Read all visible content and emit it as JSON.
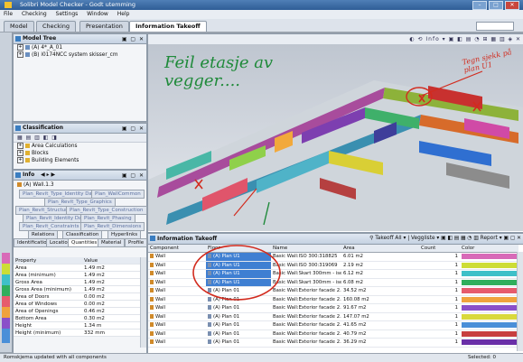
{
  "window": {
    "title": "Solibri Model Checker - Godt utemming"
  },
  "menu": [
    "File",
    "Checking",
    "Settings",
    "Window",
    "Help"
  ],
  "tabs": [
    {
      "label": "Model",
      "active": false
    },
    {
      "label": "Checking",
      "active": false
    },
    {
      "label": "Presentation",
      "active": false
    },
    {
      "label": "Information Takeoff",
      "active": true
    }
  ],
  "model_tree": {
    "title": "Model Tree",
    "items": [
      {
        "label": "(A) 4*_A_01"
      },
      {
        "label": "(B) i0174NCC system skisser_cm"
      }
    ]
  },
  "classification": {
    "title": "Classification",
    "items": [
      "Area Calculations",
      "Blocks",
      "Building Elements"
    ]
  },
  "info": {
    "title": "Info",
    "selection": "(A) Wall.1.3",
    "prop_tabs_row1": [
      "Plan_Revit_Type_Identity Data",
      "Plan_WallCommon"
    ],
    "prop_tabs_row2": [
      "Plan_Revit_Type_Graphics"
    ],
    "prop_tabs_row3": [
      "Plan_Revit_Structural",
      "Plan_Revit_Type_Construction"
    ],
    "prop_tabs_row4": [
      "Plan_Revit_Identity Data",
      "Plan_Revit_Phasing"
    ],
    "prop_tabs_row5": [
      "Plan_Revit_Constraints",
      "Plan_Revit_Dimensions"
    ],
    "prop_tabs_row6": [
      "Relations",
      "Classification",
      "Hyperlinks"
    ],
    "prop_tabs_row7": [
      "Identification",
      "Location",
      "Quantities",
      "Material",
      "Profile"
    ],
    "columns": [
      "Property",
      "Value"
    ],
    "rows": [
      [
        "Area",
        "1.49 m2"
      ],
      [
        "Area (minimum)",
        "1.49 m2"
      ],
      [
        "Gross Area",
        "1.49 m2"
      ],
      [
        "Gross Area (minimum)",
        "1.49 m2"
      ],
      [
        "Area of Doors",
        "0.00 m2"
      ],
      [
        "Area of Windows",
        "0.00 m2"
      ],
      [
        "Area of Openings",
        "0.46 m2"
      ],
      [
        "Bottom Area",
        "0.30 m2"
      ],
      [
        "Height",
        "1.34 m"
      ],
      [
        "Height (minimum)",
        "332 mm"
      ]
    ]
  },
  "takeoff": {
    "title": "Information Takeoff",
    "toolbar_takeoff": "Takeoff All",
    "toolbar_veggliste": "Veggliste",
    "toolbar_report": "Report",
    "columns": [
      "Component",
      "Floor",
      "Name",
      "Area",
      "Count",
      "Color"
    ],
    "rows": [
      {
        "component": "Wall",
        "floor": "(A) Plan U1",
        "name": "Basic Wall:ISO 300:318825",
        "area": "6.01 m2",
        "count": "1",
        "color": "#d86ab8",
        "selected": true
      },
      {
        "component": "Wall",
        "floor": "(A) Plan U1",
        "name": "Basic Wall:ISO 300:319069",
        "area": "2.19 m2",
        "count": "1",
        "color": "#cddd36",
        "selected": true
      },
      {
        "component": "Wall",
        "floor": "(A) Plan U1",
        "name": "Basic Wall:Skart 300mm - ise...",
        "area": "6.12 m2",
        "count": "1",
        "color": "#3ec0c8",
        "selected": true
      },
      {
        "component": "Wall",
        "floor": "(A) Plan U1",
        "name": "Basic Wall:Skart 300mm - ise...",
        "area": "6.08 m2",
        "count": "1",
        "color": "#2fae5c",
        "selected": true
      },
      {
        "component": "Wall",
        "floor": "(A) Plan 01",
        "name": "Basic Wall:Exterior facade 2...",
        "area": "34.52 m2",
        "count": "1",
        "color": "#e65b6d",
        "selected": false
      },
      {
        "component": "Wall",
        "floor": "(A) Plan 01",
        "name": "Basic Wall:Exterior facade 2...",
        "area": "160.08 m2",
        "count": "1",
        "color": "#f0a23d",
        "selected": false
      },
      {
        "component": "Wall",
        "floor": "(A) Plan 01",
        "name": "Basic Wall:Exterior facade 2...",
        "area": "91.67 m2",
        "count": "1",
        "color": "#8a4fc9",
        "selected": false
      },
      {
        "component": "Wall",
        "floor": "(A) Plan 01",
        "name": "Basic Wall:Exterior facade 2...",
        "area": "147.07 m2",
        "count": "1",
        "color": "#d9d93c",
        "selected": false
      },
      {
        "component": "Wall",
        "floor": "(A) Plan 01",
        "name": "Basic Wall:Exterior facade 2...",
        "area": "41.65 m2",
        "count": "1",
        "color": "#4a8fd8",
        "selected": false
      },
      {
        "component": "Wall",
        "floor": "(A) Plan 01",
        "name": "Basic Wall:Exterior facade 2...",
        "area": "40.79 m2",
        "count": "1",
        "color": "#c73f3f",
        "selected": false
      },
      {
        "component": "Wall",
        "floor": "(A) Plan 01",
        "name": "Basic Wall:Exterior facade 2...",
        "area": "36.29 m2",
        "count": "1",
        "color": "#6a2fa8",
        "selected": false
      }
    ]
  },
  "viewer": {
    "annotation_main": "Feil etasje av vegger....",
    "annotation_side": "Tegn sjekk på plan U1"
  },
  "status": {
    "message": "Romskjema updated with all components",
    "selected": "Selected: 0"
  },
  "colors": {
    "accent": "#3f7fd2",
    "annotation": "#1f8a3a",
    "annotation_red": "#d22b1e"
  }
}
